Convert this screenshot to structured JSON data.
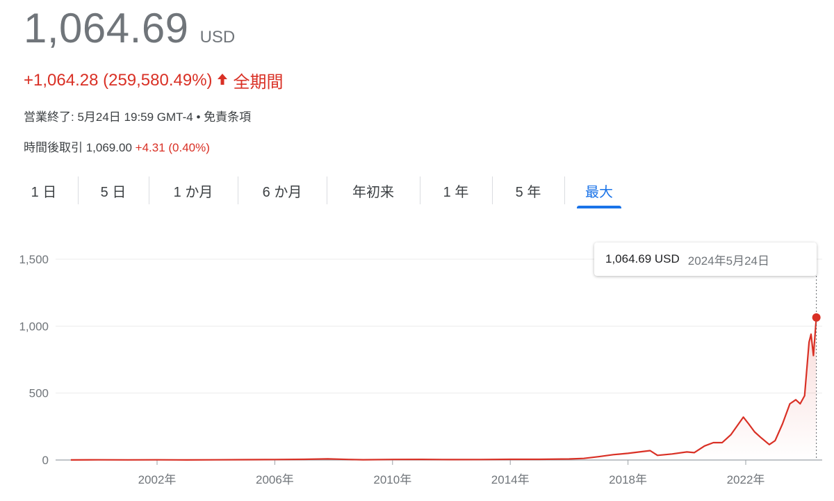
{
  "quote": {
    "price": "1,064.69",
    "currency": "USD",
    "change": "+1,064.28 (259,580.49%)",
    "period": "全期間",
    "closed_text": "営業終了: 5月24日 19:59 GMT-4 • 免責条項",
    "after_hours_label": "時間後取引 1,069.00",
    "after_hours_change": "+4.31 (0.40%)"
  },
  "colors": {
    "positive": "#d93025",
    "accent": "#1a73e8",
    "line": "#d93025"
  },
  "tabs": [
    {
      "label": "1 日",
      "active": false
    },
    {
      "label": "5 日",
      "active": false
    },
    {
      "label": "1 か月",
      "active": false
    },
    {
      "label": "6 か月",
      "active": false
    },
    {
      "label": "年初来",
      "active": false
    },
    {
      "label": "1 年",
      "active": false
    },
    {
      "label": "5 年",
      "active": false
    },
    {
      "label": "最大",
      "active": true
    }
  ],
  "tooltip": {
    "price": "1,064.69 USD",
    "date": "2024年5月24日"
  },
  "chart_data": {
    "type": "line",
    "title": "",
    "xlabel": "",
    "ylabel": "",
    "ylim": [
      0,
      1500
    ],
    "xlim": [
      1999.07,
      2024.4
    ],
    "yticks": [
      0,
      500,
      1000,
      1500
    ],
    "ytick_labels": [
      "0",
      "500",
      "1,000",
      "1,500"
    ],
    "xticks": [
      2002,
      2006,
      2010,
      2014,
      2018,
      2022
    ],
    "xtick_labels": [
      "2002年",
      "2006年",
      "2010年",
      "2014年",
      "2018年",
      "2022年"
    ],
    "grid": true,
    "series": [
      {
        "values": [
          [
            1999.07,
            0.41
          ],
          [
            2000.0,
            1.5
          ],
          [
            2001.0,
            1.0
          ],
          [
            2002.0,
            1.4
          ],
          [
            2003.0,
            0.6
          ],
          [
            2004.0,
            1.6
          ],
          [
            2005.0,
            2.5
          ],
          [
            2006.0,
            3.5
          ],
          [
            2007.0,
            5.0
          ],
          [
            2007.8,
            8.5
          ],
          [
            2008.5,
            4.0
          ],
          [
            2009.0,
            2.0
          ],
          [
            2010.0,
            4.0
          ],
          [
            2011.0,
            4.5
          ],
          [
            2012.0,
            3.0
          ],
          [
            2013.0,
            3.5
          ],
          [
            2014.0,
            5.0
          ],
          [
            2015.0,
            5.0
          ],
          [
            2016.0,
            8.0
          ],
          [
            2016.5,
            12.0
          ],
          [
            2017.0,
            25.0
          ],
          [
            2017.5,
            40.0
          ],
          [
            2018.0,
            50.0
          ],
          [
            2018.75,
            70.0
          ],
          [
            2019.0,
            35.0
          ],
          [
            2019.5,
            45.0
          ],
          [
            2020.0,
            60.0
          ],
          [
            2020.25,
            55.0
          ],
          [
            2020.6,
            105.0
          ],
          [
            2020.9,
            130.0
          ],
          [
            2021.2,
            130.0
          ],
          [
            2021.5,
            190.0
          ],
          [
            2021.92,
            320.0
          ],
          [
            2022.1,
            270.0
          ],
          [
            2022.3,
            210.0
          ],
          [
            2022.5,
            170.0
          ],
          [
            2022.8,
            115.0
          ],
          [
            2023.0,
            145.0
          ],
          [
            2023.25,
            270.0
          ],
          [
            2023.5,
            420.0
          ],
          [
            2023.7,
            450.0
          ],
          [
            2023.85,
            420.0
          ],
          [
            2024.0,
            480.0
          ],
          [
            2024.15,
            880.0
          ],
          [
            2024.22,
            940.0
          ],
          [
            2024.3,
            780.0
          ],
          [
            2024.36,
            950.0
          ],
          [
            2024.4,
            1064.69
          ]
        ]
      }
    ],
    "last_point": [
      2024.4,
      1064.69
    ]
  }
}
